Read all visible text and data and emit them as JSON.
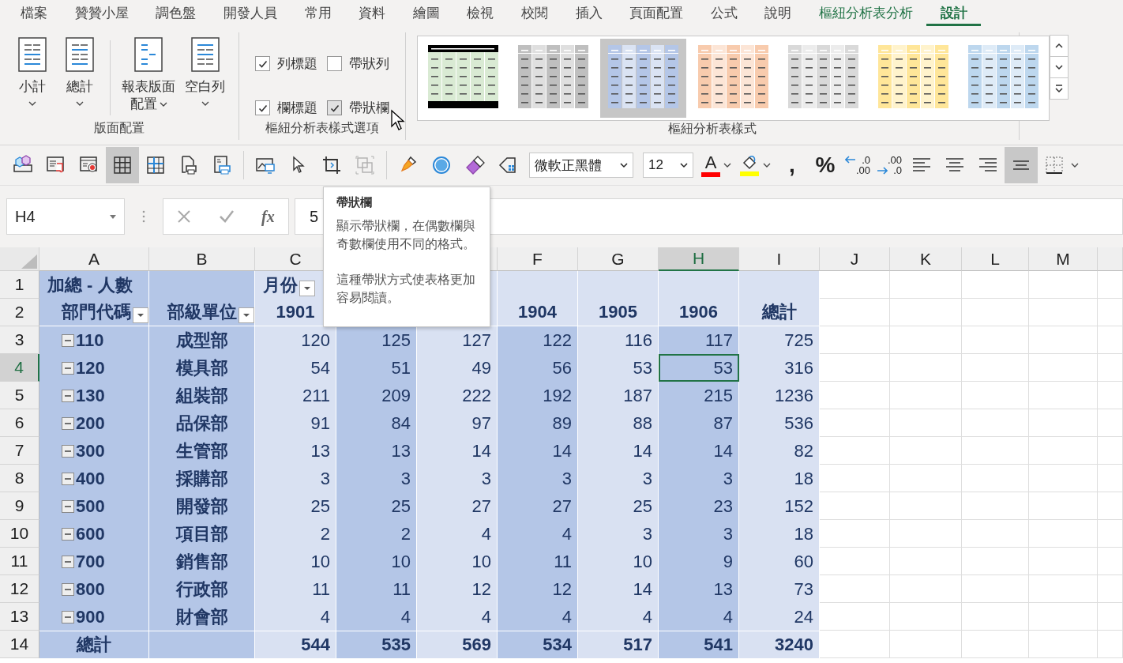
{
  "menu": [
    {
      "label": "檔案",
      "selected": false,
      "kind": "normal"
    },
    {
      "label": "贊贊小屋",
      "selected": false,
      "kind": "normal"
    },
    {
      "label": "調色盤",
      "selected": false,
      "kind": "normal"
    },
    {
      "label": "開發人員",
      "selected": false,
      "kind": "normal"
    },
    {
      "label": "常用",
      "selected": false,
      "kind": "normal"
    },
    {
      "label": "資料",
      "selected": false,
      "kind": "normal"
    },
    {
      "label": "繪圖",
      "selected": false,
      "kind": "normal"
    },
    {
      "label": "檢視",
      "selected": false,
      "kind": "normal"
    },
    {
      "label": "校閱",
      "selected": false,
      "kind": "normal"
    },
    {
      "label": "插入",
      "selected": false,
      "kind": "normal"
    },
    {
      "label": "頁面配置",
      "selected": false,
      "kind": "normal"
    },
    {
      "label": "公式",
      "selected": false,
      "kind": "normal"
    },
    {
      "label": "說明",
      "selected": false,
      "kind": "normal"
    },
    {
      "label": "樞紐分析表分析",
      "selected": false,
      "kind": "contextual"
    },
    {
      "label": "設計",
      "selected": true,
      "kind": "contextual"
    }
  ],
  "ribbon": {
    "layout": {
      "label": "版面配置",
      "buttons": [
        {
          "lines": [
            "小計"
          ]
        },
        {
          "lines": [
            "總計"
          ]
        },
        {
          "lines": [
            "報表版面",
            "配置"
          ]
        },
        {
          "lines": [
            "空白列"
          ]
        }
      ]
    },
    "options": {
      "label": "樞紐分析表樣式選項",
      "checkboxes": [
        {
          "label": "列標題",
          "checked": true,
          "hovered": false
        },
        {
          "label": "帶狀列",
          "checked": false,
          "hovered": false
        },
        {
          "label": "欄標題",
          "checked": true,
          "hovered": false
        },
        {
          "label": "帶狀欄",
          "checked": true,
          "hovered": true
        }
      ]
    },
    "styles": {
      "label": "樞紐分析表樣式",
      "items": [
        {
          "kind": "framed",
          "color": "#d9ead3",
          "selected": false
        },
        {
          "kind": "banded",
          "color": "#bfbfbf",
          "selected": false
        },
        {
          "kind": "banded",
          "color": "#b4c6e7",
          "selected": true
        },
        {
          "kind": "banded",
          "color": "#f8cbad",
          "selected": false
        },
        {
          "kind": "banded",
          "color": "#d9d9d9",
          "selected": false
        },
        {
          "kind": "banded",
          "color": "#ffe699",
          "selected": false
        },
        {
          "kind": "banded",
          "color": "#bdd7ee",
          "selected": false
        }
      ]
    }
  },
  "toolbar": [
    {
      "kind": "icon",
      "pressed": false,
      "disabled": false
    },
    {
      "kind": "icon",
      "pressed": false,
      "disabled": false
    },
    {
      "kind": "icon",
      "pressed": false,
      "disabled": false
    },
    {
      "kind": "icon",
      "pressed": true,
      "disabled": false
    },
    {
      "kind": "icon",
      "pressed": false,
      "disabled": false
    },
    {
      "kind": "icon",
      "pressed": false,
      "disabled": false
    },
    {
      "kind": "icon",
      "pressed": false,
      "disabled": false
    },
    {
      "kind": "separator"
    },
    {
      "kind": "icon",
      "pressed": false,
      "disabled": false
    },
    {
      "kind": "icon",
      "pressed": false,
      "disabled": false
    },
    {
      "kind": "icon",
      "pressed": false,
      "disabled": false
    },
    {
      "kind": "icon",
      "pressed": false,
      "disabled": true
    },
    {
      "kind": "separator"
    },
    {
      "kind": "icon",
      "pressed": false,
      "disabled": false
    },
    {
      "kind": "icon",
      "pressed": false,
      "disabled": false
    },
    {
      "kind": "icon",
      "pressed": false,
      "disabled": false
    },
    {
      "kind": "icon",
      "pressed": false,
      "disabled": false
    },
    {
      "kind": "select",
      "value": "微軟正黑體"
    },
    {
      "kind": "select",
      "value": "12"
    },
    {
      "kind": "color",
      "label": "A",
      "color": "#ff0000"
    },
    {
      "kind": "fill",
      "color": "#ffff00"
    },
    {
      "kind": "text",
      "label": ",",
      "pressed": false
    },
    {
      "kind": "text",
      "label": "%",
      "pressed": false
    },
    {
      "kind": "decimal",
      "lines": [
        ".0",
        ".00"
      ]
    },
    {
      "kind": "decimal",
      "lines": [
        ".00",
        ".0"
      ]
    },
    {
      "kind": "align",
      "pressed": false
    },
    {
      "kind": "align",
      "pressed": false
    },
    {
      "kind": "align",
      "pressed": false
    },
    {
      "kind": "align",
      "pressed": true
    },
    {
      "kind": "borders"
    }
  ],
  "formula_bar": {
    "name_box": "H4",
    "fx_label": "fx",
    "value": "5"
  },
  "tooltip": {
    "title": "帶狀欄",
    "paragraphs": [
      "顯示帶狀欄，在偶數欄與奇數欄使用不同的格式。",
      "這種帶狀方式使表格更加容易閱讀。"
    ]
  },
  "sheet": {
    "columns": [
      {
        "letter": "A",
        "selected": false
      },
      {
        "letter": "B",
        "selected": false
      },
      {
        "letter": "C",
        "selected": false
      },
      {},
      {},
      {
        "letter": "F",
        "selected": false
      },
      {
        "letter": "G",
        "selected": false
      },
      {
        "letter": "H",
        "selected": true
      },
      {
        "letter": "I",
        "selected": false
      },
      {
        "letter": "J",
        "selected": false
      },
      {
        "letter": "K",
        "selected": false
      },
      {
        "letter": "L",
        "selected": false
      },
      {
        "letter": "M",
        "selected": false
      }
    ],
    "pivot_columns": [
      {
        "kind": "row-field"
      },
      {
        "kind": "row-field"
      },
      {
        "kind": "value",
        "banded": false
      },
      {
        "kind": "value",
        "banded": true
      },
      {
        "kind": "value",
        "banded": false
      },
      {
        "kind": "value",
        "banded": true
      },
      {
        "kind": "value",
        "banded": false
      },
      {
        "kind": "value",
        "banded": true
      },
      {
        "kind": "value",
        "banded": false
      }
    ],
    "rows": [
      {
        "number": "1",
        "selected": false,
        "kind": "header1",
        "cells": [
          "加總 - 人數",
          null,
          {
            "text": "月份",
            "filter": true
          },
          null,
          null,
          null,
          null,
          null,
          null
        ]
      },
      {
        "number": "2",
        "selected": false,
        "kind": "header2",
        "cells": [
          {
            "text": "部門代碼",
            "filter": true
          },
          {
            "text": "部級單位",
            "filter": true
          },
          "1901",
          null,
          null,
          "1904",
          "1905",
          "1906",
          "總計"
        ]
      },
      {
        "number": "3",
        "selected": false,
        "kind": "data",
        "expanded": true,
        "cells": [
          "110",
          "成型部",
          "120",
          "125",
          "127",
          "122",
          "116",
          "117",
          "725"
        ]
      },
      {
        "number": "4",
        "selected": true,
        "kind": "data",
        "expanded": true,
        "cells": [
          "120",
          "模具部",
          "54",
          "51",
          "49",
          "56",
          "53",
          "53",
          "316"
        ]
      },
      {
        "number": "5",
        "selected": false,
        "kind": "data",
        "expanded": true,
        "cells": [
          "130",
          "組裝部",
          "211",
          "209",
          "222",
          "192",
          "187",
          "215",
          "1236"
        ]
      },
      {
        "number": "6",
        "selected": false,
        "kind": "data",
        "expanded": true,
        "cells": [
          "200",
          "品保部",
          "91",
          "84",
          "97",
          "89",
          "88",
          "87",
          "536"
        ]
      },
      {
        "number": "7",
        "selected": false,
        "kind": "data",
        "expanded": true,
        "cells": [
          "300",
          "生管部",
          "13",
          "13",
          "14",
          "14",
          "14",
          "14",
          "82"
        ]
      },
      {
        "number": "8",
        "selected": false,
        "kind": "data",
        "expanded": true,
        "cells": [
          "400",
          "採購部",
          "3",
          "3",
          "3",
          "3",
          "3",
          "3",
          "18"
        ]
      },
      {
        "number": "9",
        "selected": false,
        "kind": "data",
        "expanded": true,
        "cells": [
          "500",
          "開發部",
          "25",
          "25",
          "27",
          "27",
          "25",
          "23",
          "152"
        ]
      },
      {
        "number": "10",
        "selected": false,
        "kind": "data",
        "expanded": true,
        "cells": [
          "600",
          "項目部",
          "2",
          "2",
          "4",
          "4",
          "3",
          "3",
          "18"
        ]
      },
      {
        "number": "11",
        "selected": false,
        "kind": "data",
        "expanded": true,
        "cells": [
          "700",
          "銷售部",
          "10",
          "10",
          "10",
          "11",
          "10",
          "9",
          "60"
        ]
      },
      {
        "number": "12",
        "selected": false,
        "kind": "data",
        "expanded": true,
        "cells": [
          "800",
          "行政部",
          "11",
          "11",
          "12",
          "12",
          "14",
          "13",
          "73"
        ]
      },
      {
        "number": "13",
        "selected": false,
        "kind": "data",
        "expanded": true,
        "cells": [
          "900",
          "財會部",
          "4",
          "4",
          "4",
          "4",
          "4",
          "4",
          "24"
        ]
      },
      {
        "number": "14",
        "selected": false,
        "kind": "total",
        "cells": [
          "總計",
          null,
          "544",
          "535",
          "569",
          "534",
          "517",
          "541",
          "3240"
        ]
      }
    ]
  }
}
